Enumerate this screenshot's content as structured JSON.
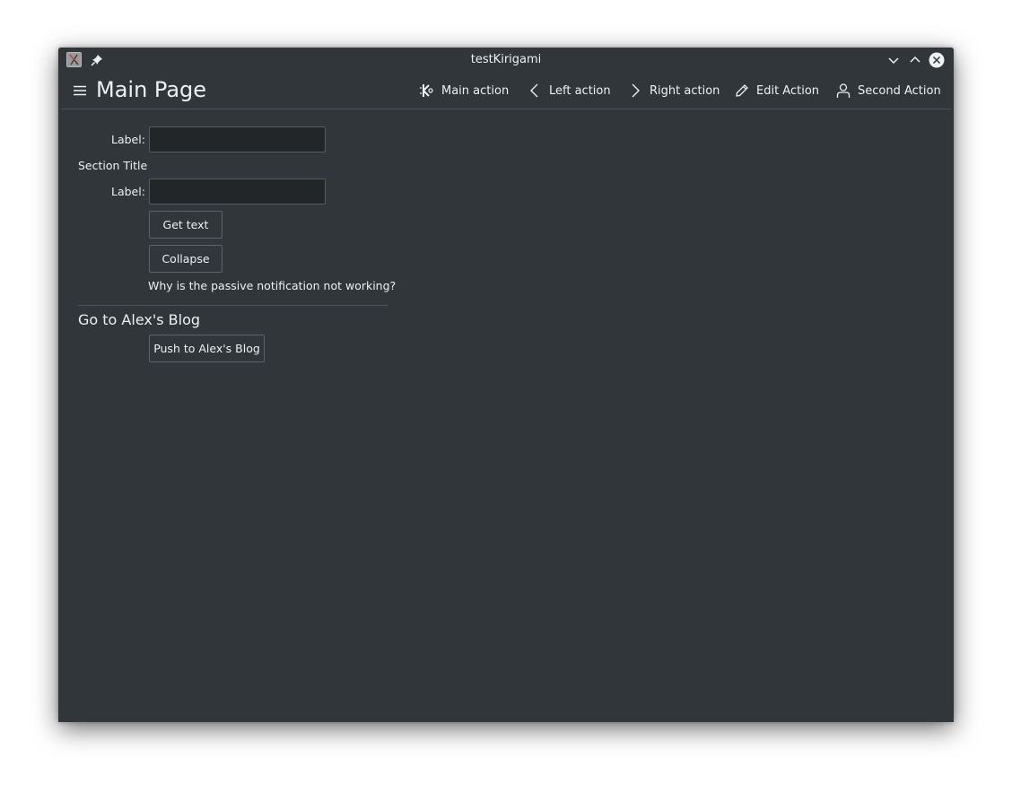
{
  "window": {
    "title": "testKirigami"
  },
  "header": {
    "title": "Main Page",
    "actions": [
      {
        "label": "Main action",
        "icon": "kde-icon"
      },
      {
        "label": "Left action",
        "icon": "chevron-left-icon"
      },
      {
        "label": "Right action",
        "icon": "chevron-right-icon"
      },
      {
        "label": "Edit Action",
        "icon": "pencil-icon"
      },
      {
        "label": "Second Action",
        "icon": "user-icon"
      }
    ]
  },
  "form": {
    "field1": {
      "label": "Label:",
      "value": ""
    },
    "section_title": "Section Title",
    "field2": {
      "label": "Label:",
      "value": ""
    },
    "get_text_label": "Get text",
    "collapse_label": "Collapse",
    "notice": "Why is the passive notification not working?"
  },
  "blog": {
    "heading": "Go to Alex's Blog",
    "push_label": "Push to Alex's Blog"
  },
  "colors": {
    "window_bg": "#31363b",
    "field_bg": "#232629",
    "text": "#eff0f1",
    "separator": "#4d5358"
  }
}
